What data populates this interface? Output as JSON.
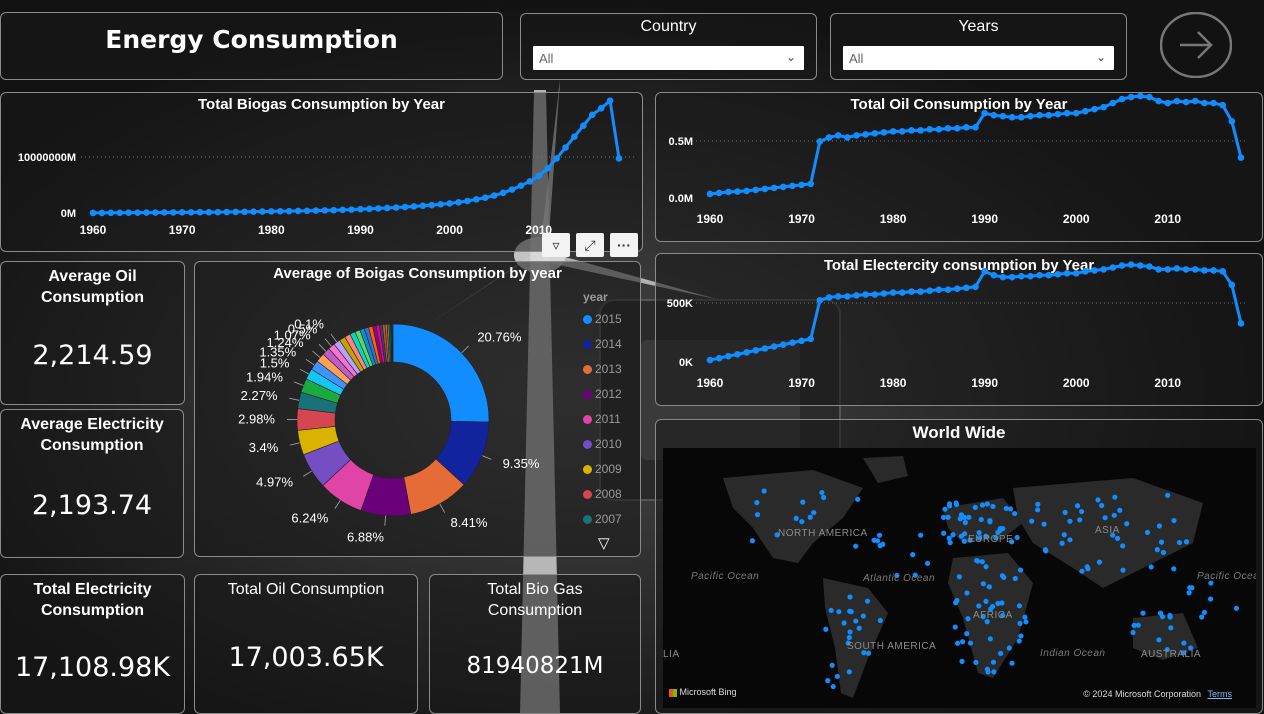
{
  "header": {
    "title": "Energy Consumption"
  },
  "slicers": {
    "country": {
      "label": "Country",
      "value": "All"
    },
    "years": {
      "label": "Years",
      "value": "All"
    }
  },
  "nav": {
    "next_icon": "arrow-right-circle-icon"
  },
  "charts": {
    "biogas": {
      "title": "Total Biogas Consumption by Year",
      "y_ticks": [
        "10000000M",
        "0M"
      ],
      "x_ticks": [
        "1960",
        "1970",
        "1980",
        "1990",
        "2000",
        "2010"
      ]
    },
    "oil": {
      "title": "Total Oil Consumption by Year",
      "y_ticks": [
        "0.5M",
        "0.0M"
      ],
      "x_ticks": [
        "1960",
        "1970",
        "1980",
        "1990",
        "2000",
        "2010"
      ]
    },
    "electricity": {
      "title": "Total Electercity consumption by Year",
      "y_ticks": [
        "500K",
        "0K"
      ],
      "x_ticks": [
        "1960",
        "1970",
        "1980",
        "1990",
        "2000",
        "2010"
      ]
    },
    "donut": {
      "title": "Average of Boigas Consumption by year",
      "legend_title": "year",
      "legend": [
        {
          "label": "2015",
          "color": "#118DFF"
        },
        {
          "label": "2014",
          "color": "#12239E"
        },
        {
          "label": "2013",
          "color": "#E66C37"
        },
        {
          "label": "2012",
          "color": "#6B007B"
        },
        {
          "label": "2011",
          "color": "#E044A7"
        },
        {
          "label": "2010",
          "color": "#744EC2"
        },
        {
          "label": "2009",
          "color": "#D9B300"
        },
        {
          "label": "2008",
          "color": "#D64550"
        },
        {
          "label": "2007",
          "color": "#197278"
        }
      ]
    },
    "map": {
      "title": "World Wide"
    }
  },
  "map_labels": {
    "north_america": "NORTH AMERICA",
    "south_america": "SOUTH AMERICA",
    "europe": "EUROPE",
    "asia": "ASIA",
    "africa": "AFRICA",
    "australia": "AUSTRALIA",
    "pacific_left": "Pacific Ocean",
    "atlantic": "Atlantic Ocean",
    "indian": "Indian Ocean",
    "pacific_right": "Pacific Ocean",
    "edge_left": "LIA",
    "bing": "Microsoft Bing",
    "copyright": "© 2024 Microsoft Corporation",
    "terms": "Terms"
  },
  "kpis": {
    "avg_oil": {
      "label": "Average Oil Consumption",
      "value": "2,214.59"
    },
    "avg_electricity": {
      "label": "Average Electricity Consumption",
      "value": "2,193.74"
    },
    "total_electricity": {
      "label": "Total Electricity Consumption",
      "value": "17,108.98K"
    },
    "total_oil": {
      "label": "Total Oil Consumption",
      "value": "17,003.65K"
    },
    "total_biogas": {
      "label": "Total Bio Gas Consumption",
      "value": "81940821M"
    }
  },
  "chart_data": [
    {
      "type": "line",
      "title": "Total Biogas Consumption by Year",
      "series": [
        {
          "values": [
            0.01,
            0.01,
            0.02,
            0.02,
            0.03,
            0.03,
            0.04,
            0.04,
            0.05,
            0.05,
            0.06,
            0.06,
            0.07,
            0.07,
            0.08,
            0.09,
            0.1,
            0.11,
            0.12,
            0.13,
            0.15,
            0.16,
            0.17,
            0.19,
            0.2,
            0.22,
            0.24,
            0.26,
            0.28,
            0.31,
            0.35,
            0.38,
            0.42,
            0.46,
            0.5,
            0.55,
            0.6,
            0.66,
            0.72,
            0.8,
            0.88,
            0.98,
            1.1,
            1.25,
            1.4,
            1.6,
            1.85,
            2.15,
            2.5,
            2.9,
            3.4,
            4.1,
            5.0,
            6.0,
            7.0,
            8.0,
            9.0,
            9.6,
            10.3,
            5.0
          ]
        }
      ],
      "x_start": 1960,
      "x_end": 2019,
      "ylim": [
        0,
        11
      ],
      "xlabel": "",
      "ylabel": ""
    },
    {
      "type": "line",
      "title": "Total Oil Consumption by Year",
      "series": [
        {
          "values": [
            0.02,
            0.025,
            0.03,
            0.032,
            0.035,
            0.04,
            0.045,
            0.05,
            0.055,
            0.06,
            0.065,
            0.07,
            0.28,
            0.3,
            0.31,
            0.3,
            0.31,
            0.315,
            0.32,
            0.325,
            0.33,
            0.33,
            0.335,
            0.335,
            0.34,
            0.34,
            0.345,
            0.345,
            0.35,
            0.35,
            0.42,
            0.41,
            0.405,
            0.4,
            0.4,
            0.405,
            0.41,
            0.41,
            0.415,
            0.42,
            0.42,
            0.43,
            0.44,
            0.45,
            0.47,
            0.49,
            0.5,
            0.505,
            0.5,
            0.48,
            0.47,
            0.48,
            0.475,
            0.48,
            0.47,
            0.47,
            0.46,
            0.38,
            0.2
          ]
        }
      ],
      "x_start": 1960,
      "x_end": 2018,
      "ylim": [
        0,
        0.52
      ],
      "xlabel": "",
      "ylabel": ""
    },
    {
      "type": "line",
      "title": "Total Electercity consumption by Year",
      "series": [
        {
          "values": [
            10,
            20,
            30,
            40,
            50,
            60,
            70,
            80,
            90,
            100,
            110,
            120,
            320,
            335,
            340,
            340,
            345,
            350,
            350,
            355,
            360,
            360,
            365,
            365,
            370,
            375,
            375,
            380,
            385,
            390,
            470,
            450,
            440,
            440,
            445,
            445,
            450,
            450,
            455,
            460,
            460,
            470,
            475,
            480,
            490,
            500,
            505,
            500,
            495,
            480,
            480,
            485,
            480,
            480,
            475,
            475,
            470,
            400,
            200
          ]
        }
      ],
      "x_start": 1960,
      "x_end": 2018,
      "ylim": [
        0,
        560
      ],
      "xlabel": "",
      "ylabel": ""
    },
    {
      "type": "pie",
      "title": "Average of Boigas Consumption by year",
      "labels": [
        "20.76%",
        "9.35%",
        "8.41%",
        "6.88%",
        "6.24%",
        "4.97%",
        "3.4%",
        "2.98%",
        "2.27%",
        "1.94%",
        "1.5%",
        "1.35%",
        "1.24%",
        "1.07%",
        "0.5%",
        "0.1%"
      ],
      "values": [
        20.76,
        9.35,
        8.41,
        6.88,
        6.24,
        4.97,
        3.4,
        2.98,
        2.27,
        1.94,
        1.5,
        1.35,
        1.24,
        1.07,
        0.95,
        0.9,
        0.85,
        0.8,
        0.75,
        0.7,
        0.65,
        0.6,
        0.55,
        0.5,
        0.45,
        0.4,
        0.35,
        0.3,
        0.25,
        0.2,
        0.15,
        0.1,
        0.1
      ],
      "colors": [
        "#118DFF",
        "#12239E",
        "#E66C37",
        "#6B007B",
        "#E044A7",
        "#744EC2",
        "#D9B300",
        "#D64550",
        "#197278",
        "#1AAB40",
        "#15C6F4",
        "#4092FF",
        "#FFA058",
        "#BE5DC9",
        "#F472D0",
        "#B5A1FF",
        "#C4A200",
        "#FF8080",
        "#00DBBC",
        "#5BD667",
        "#0091D5",
        "#4668C5",
        "#FF6300",
        "#99008A",
        "#EC008C",
        "#533285",
        "#99700A",
        "#FF4141",
        "#1F9A85",
        "#25891C",
        "#0057A2",
        "#002050",
        "#C94F0F"
      ]
    }
  ]
}
